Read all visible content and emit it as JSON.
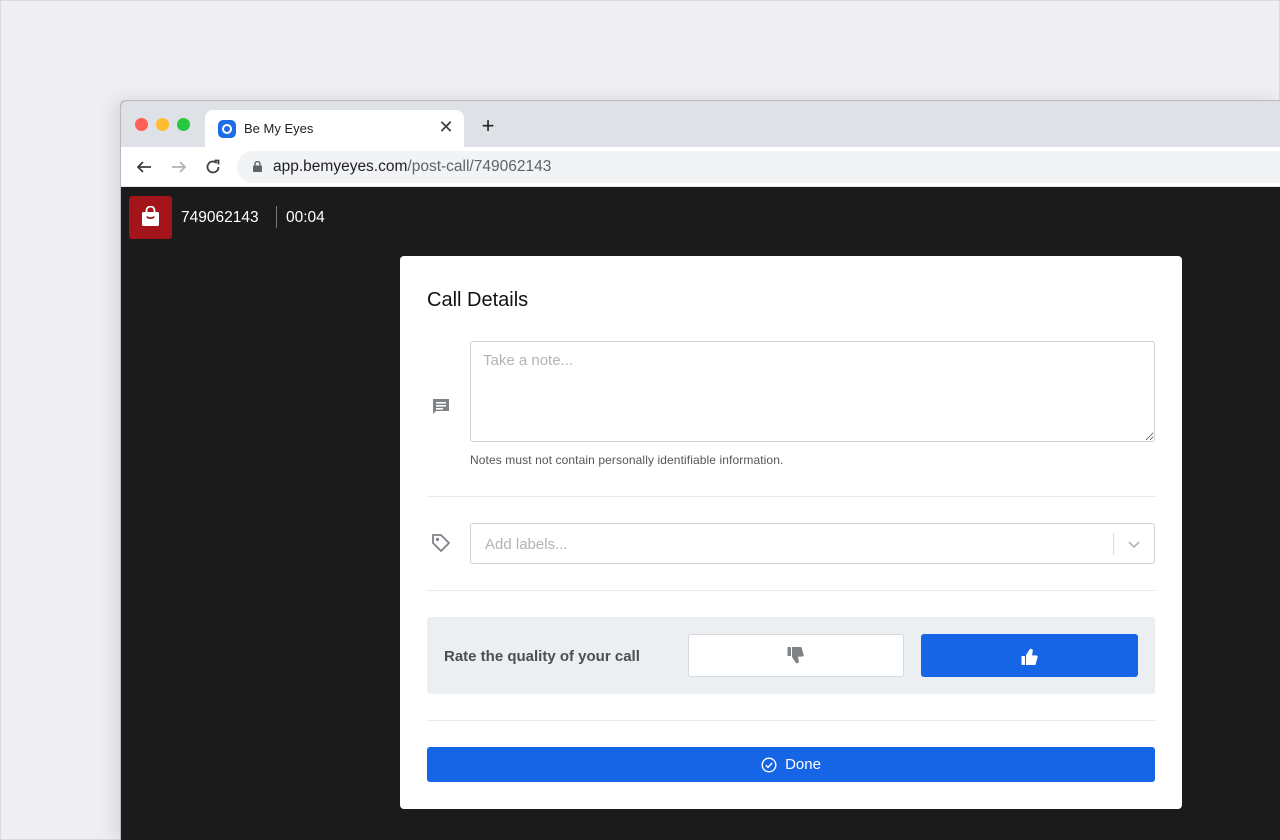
{
  "browser": {
    "tab_title": "Be My Eyes",
    "tab_close": "✕",
    "new_tab": "+",
    "url_domain": "app.bemyeyes.com",
    "url_path": "/post-call/749062143"
  },
  "call": {
    "id": "749062143",
    "timer": "00:04"
  },
  "modal": {
    "title": "Call Details",
    "note_placeholder": "Take a note...",
    "note_help": "Notes must not contain personally identifiable information.",
    "labels_placeholder": "Add labels...",
    "rate_label": "Rate the quality of your call",
    "rating_selected": "thumbs-up",
    "done_label": "Done"
  },
  "colors": {
    "accent": "#1565e6",
    "call_avatar": "#a3151b",
    "app_background": "#1b1b1b"
  }
}
